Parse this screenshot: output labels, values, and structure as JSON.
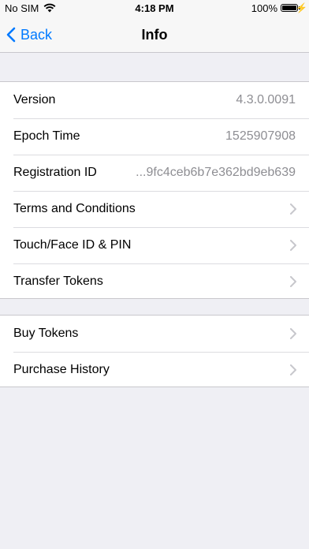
{
  "status_bar": {
    "carrier": "No SIM",
    "time": "4:18 PM",
    "battery": "100%"
  },
  "nav": {
    "back_label": "Back",
    "title": "Info"
  },
  "info": {
    "version_label": "Version",
    "version_value": "4.3.0.0091",
    "epoch_label": "Epoch Time",
    "epoch_value": "1525907908",
    "registration_label": "Registration ID",
    "registration_value": "...9fc4ceb6b7e362bd9eb639",
    "terms_label": "Terms and Conditions",
    "touchid_label": "Touch/Face ID & PIN",
    "transfer_label": "Transfer Tokens"
  },
  "tokens": {
    "buy_label": "Buy Tokens",
    "history_label": "Purchase History"
  },
  "colors": {
    "accent": "#007aff",
    "background": "#efeff4",
    "secondary_text": "#8e8e93"
  }
}
